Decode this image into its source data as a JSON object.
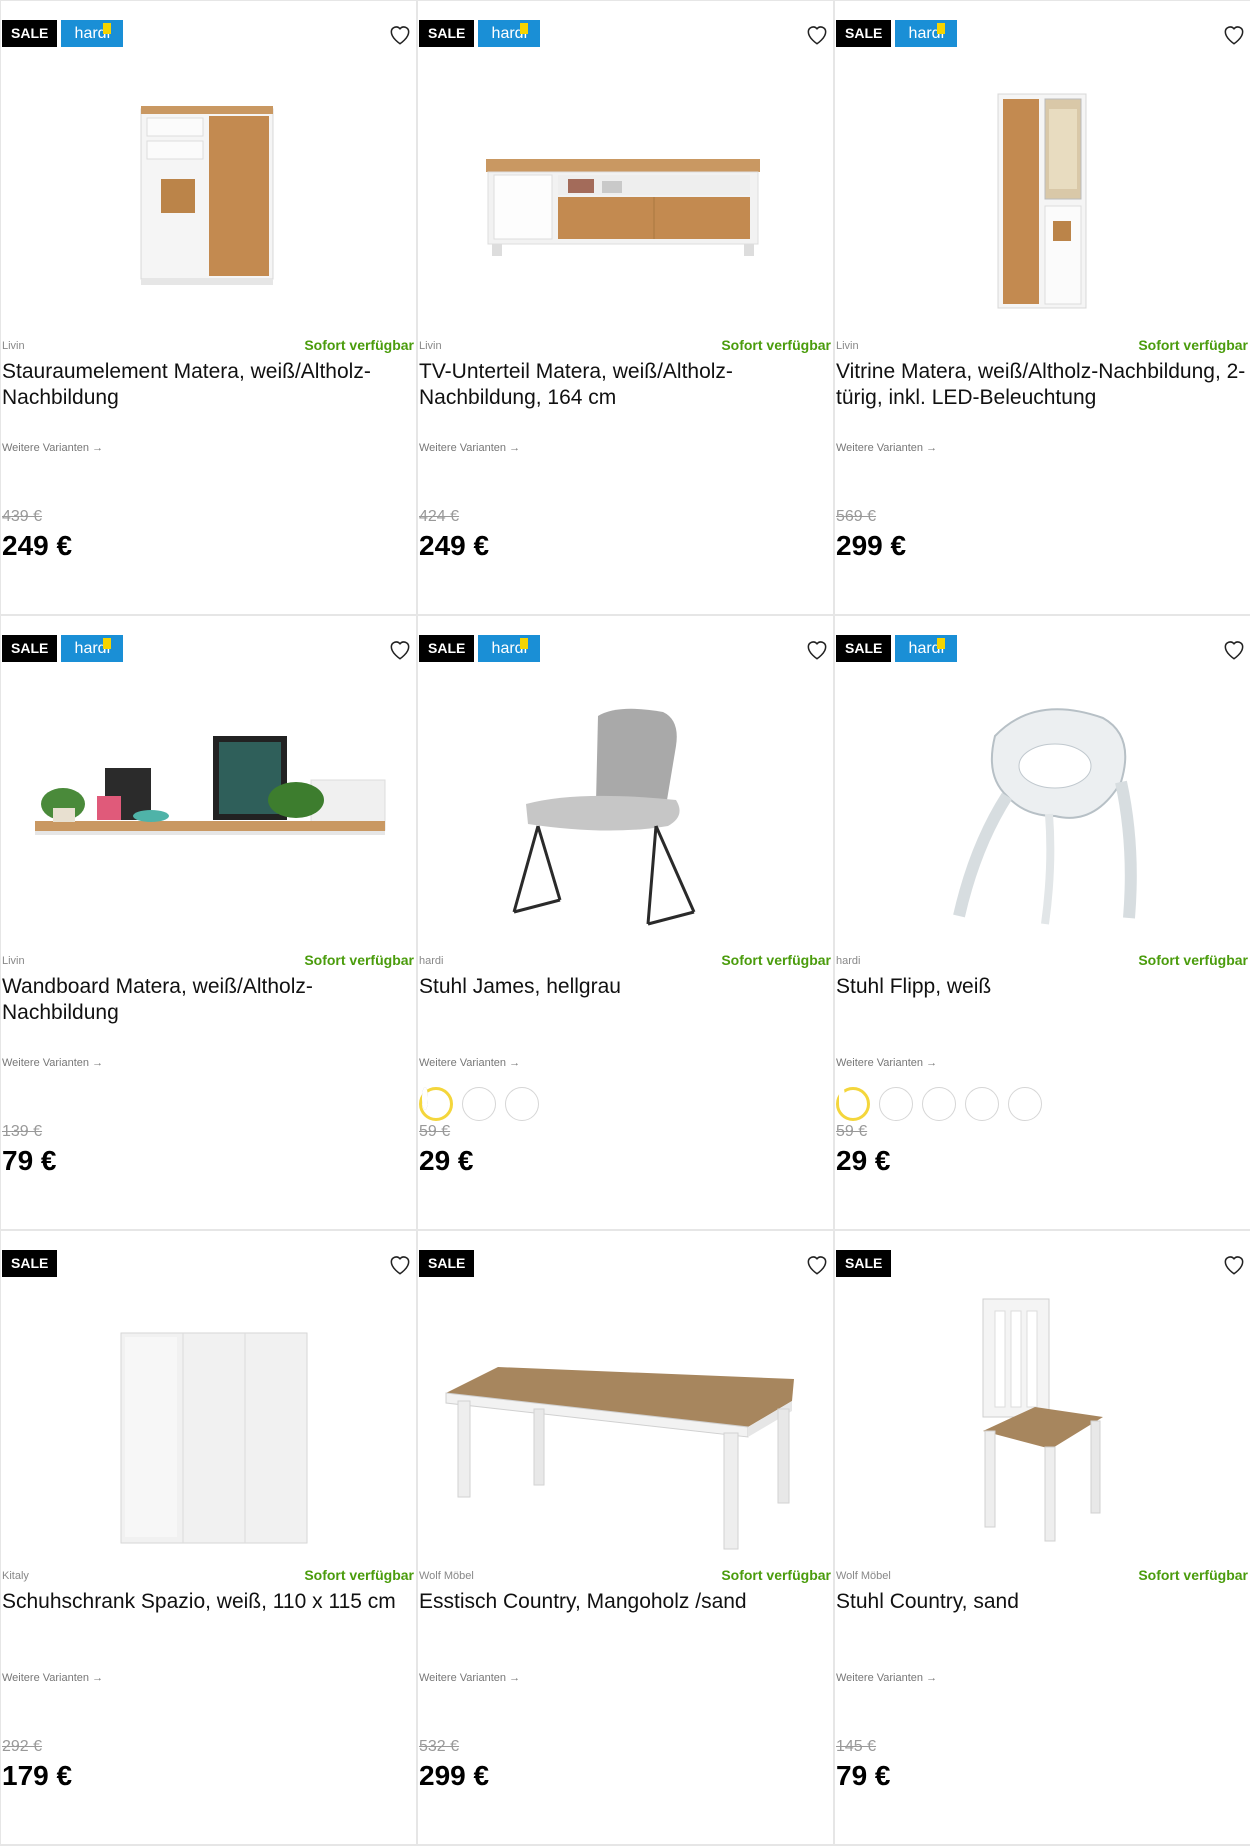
{
  "products": [
    {
      "sale": "SALE",
      "hardi": "hardi",
      "brand": "Livin",
      "availability": "Sofort verfügbar",
      "title": "Stauraumelement Matera, weiß/Altholz-Nachbildung",
      "variants": "Weitere Varianten →",
      "old_price": "439 €",
      "price": "249 €",
      "image": "highboard",
      "swatches": []
    },
    {
      "sale": "SALE",
      "hardi": "hardi",
      "brand": "Livin",
      "availability": "Sofort verfügbar",
      "title": "TV-Unterteil Matera, weiß/Altholz-Nachbildung, 164 cm",
      "variants": "Weitere Varianten →",
      "old_price": "424 €",
      "price": "249 €",
      "image": "tv-unit",
      "swatches": []
    },
    {
      "sale": "SALE",
      "hardi": "hardi",
      "brand": "Livin",
      "availability": "Sofort verfügbar",
      "title": "Vitrine Matera, weiß/Altholz-Nachbildung, 2-türig, inkl. LED-Beleuchtung",
      "variants": "Weitere Varianten →",
      "old_price": "569 €",
      "price": "299 €",
      "image": "vitrine",
      "swatches": []
    },
    {
      "sale": "SALE",
      "hardi": "hardi",
      "brand": "Livin",
      "availability": "Sofort verfügbar",
      "title": "Wandboard Matera, weiß/Altholz-Nachbildung",
      "variants": "Weitere Varianten →",
      "old_price": "139 €",
      "price": "79 €",
      "image": "wall-shelf",
      "swatches": []
    },
    {
      "sale": "SALE",
      "hardi": "hardi",
      "brand": "hardi",
      "availability": "Sofort verfügbar",
      "title": "Stuhl James, hellgrau",
      "variants": "Weitere Varianten →",
      "old_price": "59 €",
      "price": "29 €",
      "image": "chair-james",
      "swatches": [
        "#9a9a9a",
        "#8f8f8f",
        "#ffffff"
      ]
    },
    {
      "sale": "SALE",
      "hardi": "hardi",
      "brand": "hardi",
      "availability": "Sofort verfügbar",
      "title": "Stuhl Flipp, weiß",
      "variants": "Weitere Varianten →",
      "old_price": "59 €",
      "price": "29 €",
      "image": "chair-flipp",
      "swatches": [
        "#ffffff",
        "#8f8f8f",
        "#4a9a1c",
        "#f08a00",
        "#000000"
      ]
    },
    {
      "sale": "SALE",
      "hardi": "",
      "brand": "Kitaly",
      "availability": "Sofort verfügbar",
      "title": "Schuhschrank Spazio, weiß, 110 x 115 cm",
      "variants": "Weitere Varianten →",
      "old_price": "292 €",
      "price": "179 €",
      "image": "shoe-cabinet",
      "swatches": []
    },
    {
      "sale": "SALE",
      "hardi": "",
      "brand": "Wolf Möbel",
      "availability": "Sofort verfügbar",
      "title": "Esstisch Country, Mangoholz /sand",
      "variants": "Weitere Varianten →",
      "old_price": "532 €",
      "price": "299 €",
      "image": "dining-table",
      "swatches": []
    },
    {
      "sale": "SALE",
      "hardi": "",
      "brand": "Wolf Möbel",
      "availability": "Sofort verfügbar",
      "title": "Stuhl Country, sand",
      "variants": "Weitere Varianten →",
      "old_price": "145 €",
      "price": "79 €",
      "image": "chair-country",
      "swatches": []
    }
  ]
}
